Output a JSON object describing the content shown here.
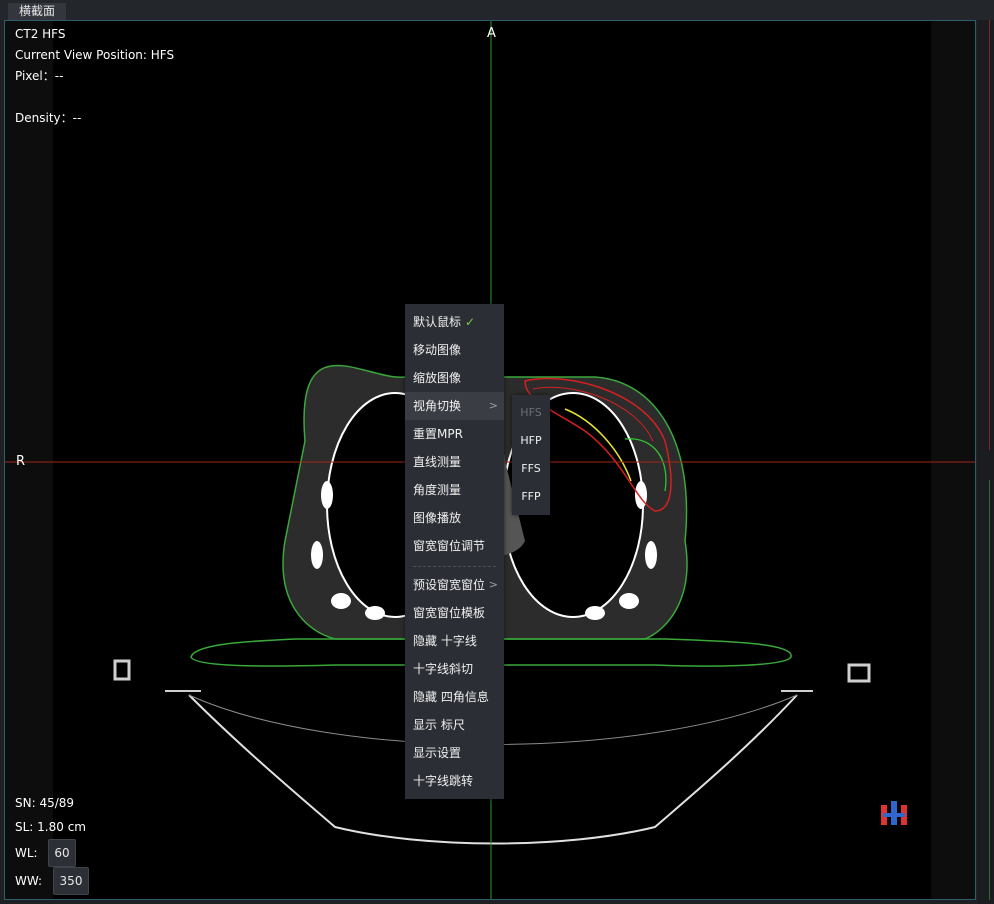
{
  "tab": {
    "label": "横截面"
  },
  "overlay": {
    "series": "CT2 HFS",
    "view_position": "Current View Position: HFS",
    "pixel": "Pixel：--",
    "density": "Density：--",
    "sn": "SN: 45/89",
    "sl": "SL: 1.80 cm",
    "wl_label": "WL:",
    "wl_value": "60",
    "ww_label": "WW:",
    "ww_value": "350"
  },
  "orientation": {
    "top": "A",
    "left": "R"
  },
  "crosshair": {
    "vertical_color": "#2e9a2e",
    "horizontal_color": "#a02818"
  },
  "context_menu": {
    "items": [
      {
        "label": "默认鼠标",
        "checked": true
      },
      {
        "label": "移动图像"
      },
      {
        "label": "缩放图像"
      },
      {
        "label": "视角切换",
        "submenu": true
      },
      {
        "label": "重置MPR"
      },
      {
        "label": "直线测量"
      },
      {
        "label": "角度测量"
      },
      {
        "label": "图像播放"
      },
      {
        "label": "窗宽窗位调节"
      },
      {
        "label": "预设窗宽窗位",
        "submenu": true
      },
      {
        "label": "窗宽窗位模板"
      },
      {
        "label": "隐藏 十字线"
      },
      {
        "label": "十字线斜切"
      },
      {
        "label": "隐藏 四角信息"
      },
      {
        "label": "显示 标尺"
      },
      {
        "label": "显示设置"
      },
      {
        "label": "十字线跳转"
      }
    ],
    "check_icon": "check-icon",
    "chevron_icon": "chevron-right-icon"
  },
  "submenu": {
    "items": [
      {
        "label": "HFS",
        "disabled": true
      },
      {
        "label": "HFP"
      },
      {
        "label": "FFS"
      },
      {
        "label": "FFP"
      }
    ]
  },
  "icons": {
    "logo": "logo-icon"
  }
}
